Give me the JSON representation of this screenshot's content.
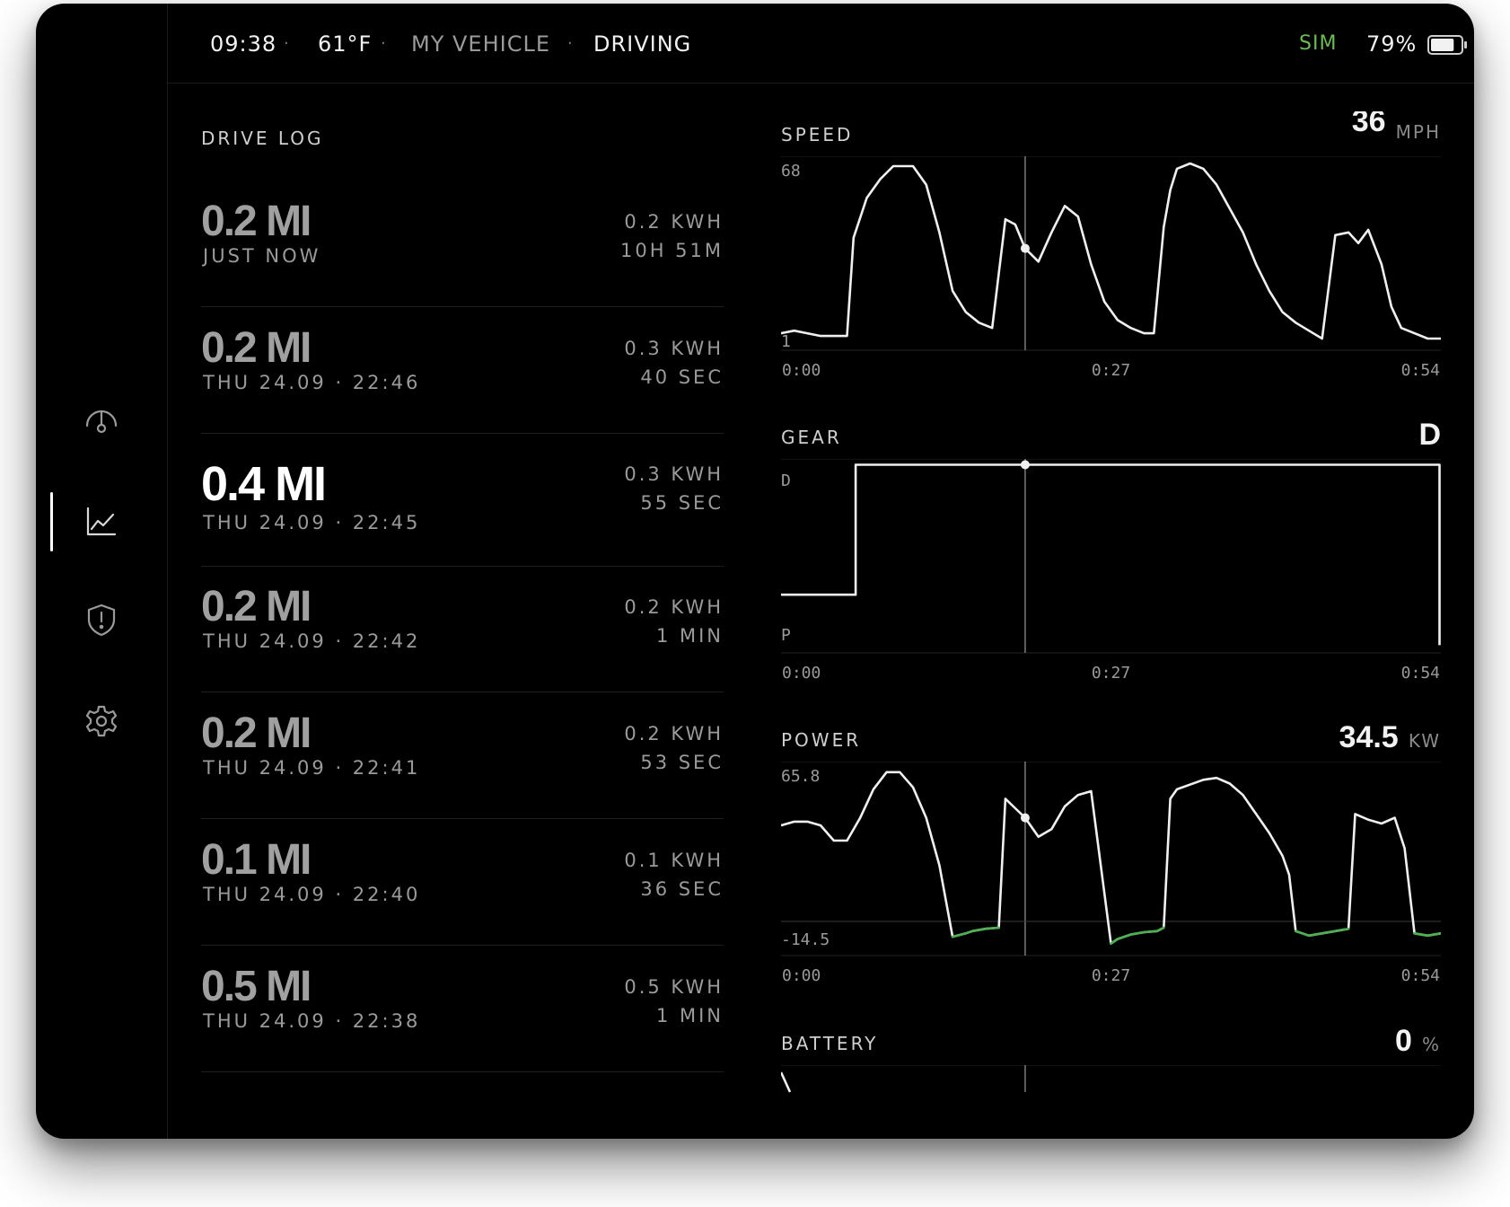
{
  "status_bar": {
    "time": "09:38",
    "temperature": "61°F",
    "vehicle_name": "MY VEHICLE",
    "state": "DRIVING",
    "separator": "·",
    "sim_label": "SIM",
    "battery_percent": "79%",
    "battery_level": 0.79
  },
  "sidebar": {
    "items": [
      {
        "icon": "gauge-icon",
        "active": false
      },
      {
        "icon": "chart-icon",
        "active": true
      },
      {
        "icon": "shield-alert-icon",
        "active": false
      },
      {
        "icon": "gear-icon",
        "active": false
      }
    ]
  },
  "drive_log": {
    "title": "DRIVE LOG",
    "entries": [
      {
        "distance": "0.2 MI",
        "date": "JUST NOW",
        "energy": "0.2 KWH",
        "duration": "10H 51M",
        "active": false
      },
      {
        "distance": "0.2 MI",
        "date": "THU 24.09 · 22:46",
        "energy": "0.3 KWH",
        "duration": "40 SEC",
        "active": false
      },
      {
        "distance": "0.4 MI",
        "date": "THU 24.09 · 22:45",
        "energy": "0.3 KWH",
        "duration": "55 SEC",
        "active": true
      },
      {
        "distance": "0.2 MI",
        "date": "THU 24.09 · 22:42",
        "energy": "0.2 KWH",
        "duration": "1 MIN",
        "active": false
      },
      {
        "distance": "0.2 MI",
        "date": "THU 24.09 · 22:41",
        "energy": "0.2 KWH",
        "duration": "53 SEC",
        "active": false
      },
      {
        "distance": "0.1 MI",
        "date": "THU 24.09 · 22:40",
        "energy": "0.1 KWH",
        "duration": "36 SEC",
        "active": false
      },
      {
        "distance": "0.5 MI",
        "date": "THU 24.09 · 22:38",
        "energy": "0.5 KWH",
        "duration": "1 MIN",
        "active": false
      }
    ]
  },
  "charts": {
    "speed": {
      "title": "SPEED",
      "value": "36",
      "unit": "MPH"
    },
    "gear": {
      "title": "GEAR",
      "value": "D"
    },
    "power": {
      "title": "POWER",
      "value": "34.5",
      "unit": "KW"
    },
    "battery": {
      "title": "BATTERY",
      "value": "0",
      "unit": "%"
    }
  },
  "chart_data": [
    {
      "type": "line",
      "title": "SPEED",
      "ylim": [
        1,
        68
      ],
      "ytick_labels": [
        "68",
        "1"
      ],
      "xtick_labels": [
        "0:00",
        "0:27",
        "0:54"
      ],
      "cursor_x": 0.37,
      "x": [
        0.0,
        0.02,
        0.06,
        0.1,
        0.11,
        0.13,
        0.15,
        0.17,
        0.2,
        0.22,
        0.24,
        0.26,
        0.28,
        0.3,
        0.32,
        0.34,
        0.355,
        0.37,
        0.39,
        0.41,
        0.43,
        0.45,
        0.47,
        0.49,
        0.51,
        0.53,
        0.55,
        0.565,
        0.58,
        0.59,
        0.6,
        0.62,
        0.64,
        0.66,
        0.68,
        0.7,
        0.72,
        0.74,
        0.76,
        0.78,
        0.8,
        0.82,
        0.84,
        0.86,
        0.875,
        0.89,
        0.91,
        0.925,
        0.94,
        0.96,
        0.98,
        1.0
      ],
      "values": [
        4,
        5,
        3,
        3,
        40,
        55,
        62,
        67,
        67,
        60,
        42,
        20,
        12,
        8,
        6,
        47,
        45,
        36,
        31,
        42,
        52,
        48,
        30,
        16,
        9,
        6,
        4,
        4,
        44,
        58,
        66,
        68,
        66,
        60,
        51,
        42,
        30,
        20,
        12,
        8,
        5,
        2,
        41,
        42,
        38,
        43,
        30,
        14,
        6,
        4,
        2,
        2
      ],
      "values_green": []
    },
    {
      "type": "line",
      "title": "GEAR",
      "categories": [
        "D",
        "P"
      ],
      "xtick_labels": [
        "0:00",
        "0:27",
        "0:54"
      ],
      "cursor_x": 0.37,
      "x": [
        0.0,
        0.113,
        0.113,
        0.37,
        0.998,
        0.998
      ],
      "values": [
        0.3,
        0.3,
        0.97,
        0.97,
        0.97,
        0.04
      ]
    },
    {
      "type": "line",
      "title": "POWER",
      "ylim": [
        -14.5,
        65.8
      ],
      "ytick_labels": [
        "65.8",
        "-14.5"
      ],
      "xtick_labels": [
        "0:00",
        "0:27",
        "0:54"
      ],
      "cursor_x": 0.37,
      "x": [
        0.0,
        0.02,
        0.04,
        0.06,
        0.08,
        0.1,
        0.12,
        0.14,
        0.16,
        0.18,
        0.2,
        0.22,
        0.24,
        0.26,
        0.28,
        0.29,
        0.31,
        0.33,
        0.34,
        0.355,
        0.37,
        0.39,
        0.41,
        0.43,
        0.45,
        0.47,
        0.5,
        0.51,
        0.53,
        0.55,
        0.57,
        0.58,
        0.59,
        0.6,
        0.64,
        0.66,
        0.68,
        0.7,
        0.72,
        0.74,
        0.76,
        0.77,
        0.78,
        0.8,
        0.82,
        0.84,
        0.86,
        0.87,
        0.89,
        0.91,
        0.93,
        0.945,
        0.96,
        0.98,
        1.0
      ],
      "values": [
        36,
        38,
        38,
        36,
        28,
        28,
        40,
        55,
        64,
        64,
        56,
        40,
        15,
        -28,
        -25,
        -23,
        -21,
        -20,
        50,
        45,
        40,
        30,
        34,
        46,
        52,
        54,
        -34,
        -30,
        -26,
        -24,
        -23,
        -20,
        50,
        55,
        60,
        61,
        58,
        52,
        42,
        32,
        20,
        10,
        -23,
        -27,
        -25,
        -23,
        -21,
        42,
        39,
        37,
        40,
        24,
        -25,
        -27,
        -25
      ],
      "negative_color": "#4caf50"
    },
    {
      "type": "line",
      "title": "BATTERY",
      "xtick_labels": [],
      "cursor_x": 0.37,
      "x": [
        0.0,
        0.012
      ],
      "values": [
        0.0,
        0.0
      ]
    }
  ],
  "colors": {
    "background": "#000000",
    "line": "#f0f0f0",
    "negative_power": "#4caf50",
    "sim": "#6dbb55",
    "muted_text": "#9a9a9a"
  }
}
